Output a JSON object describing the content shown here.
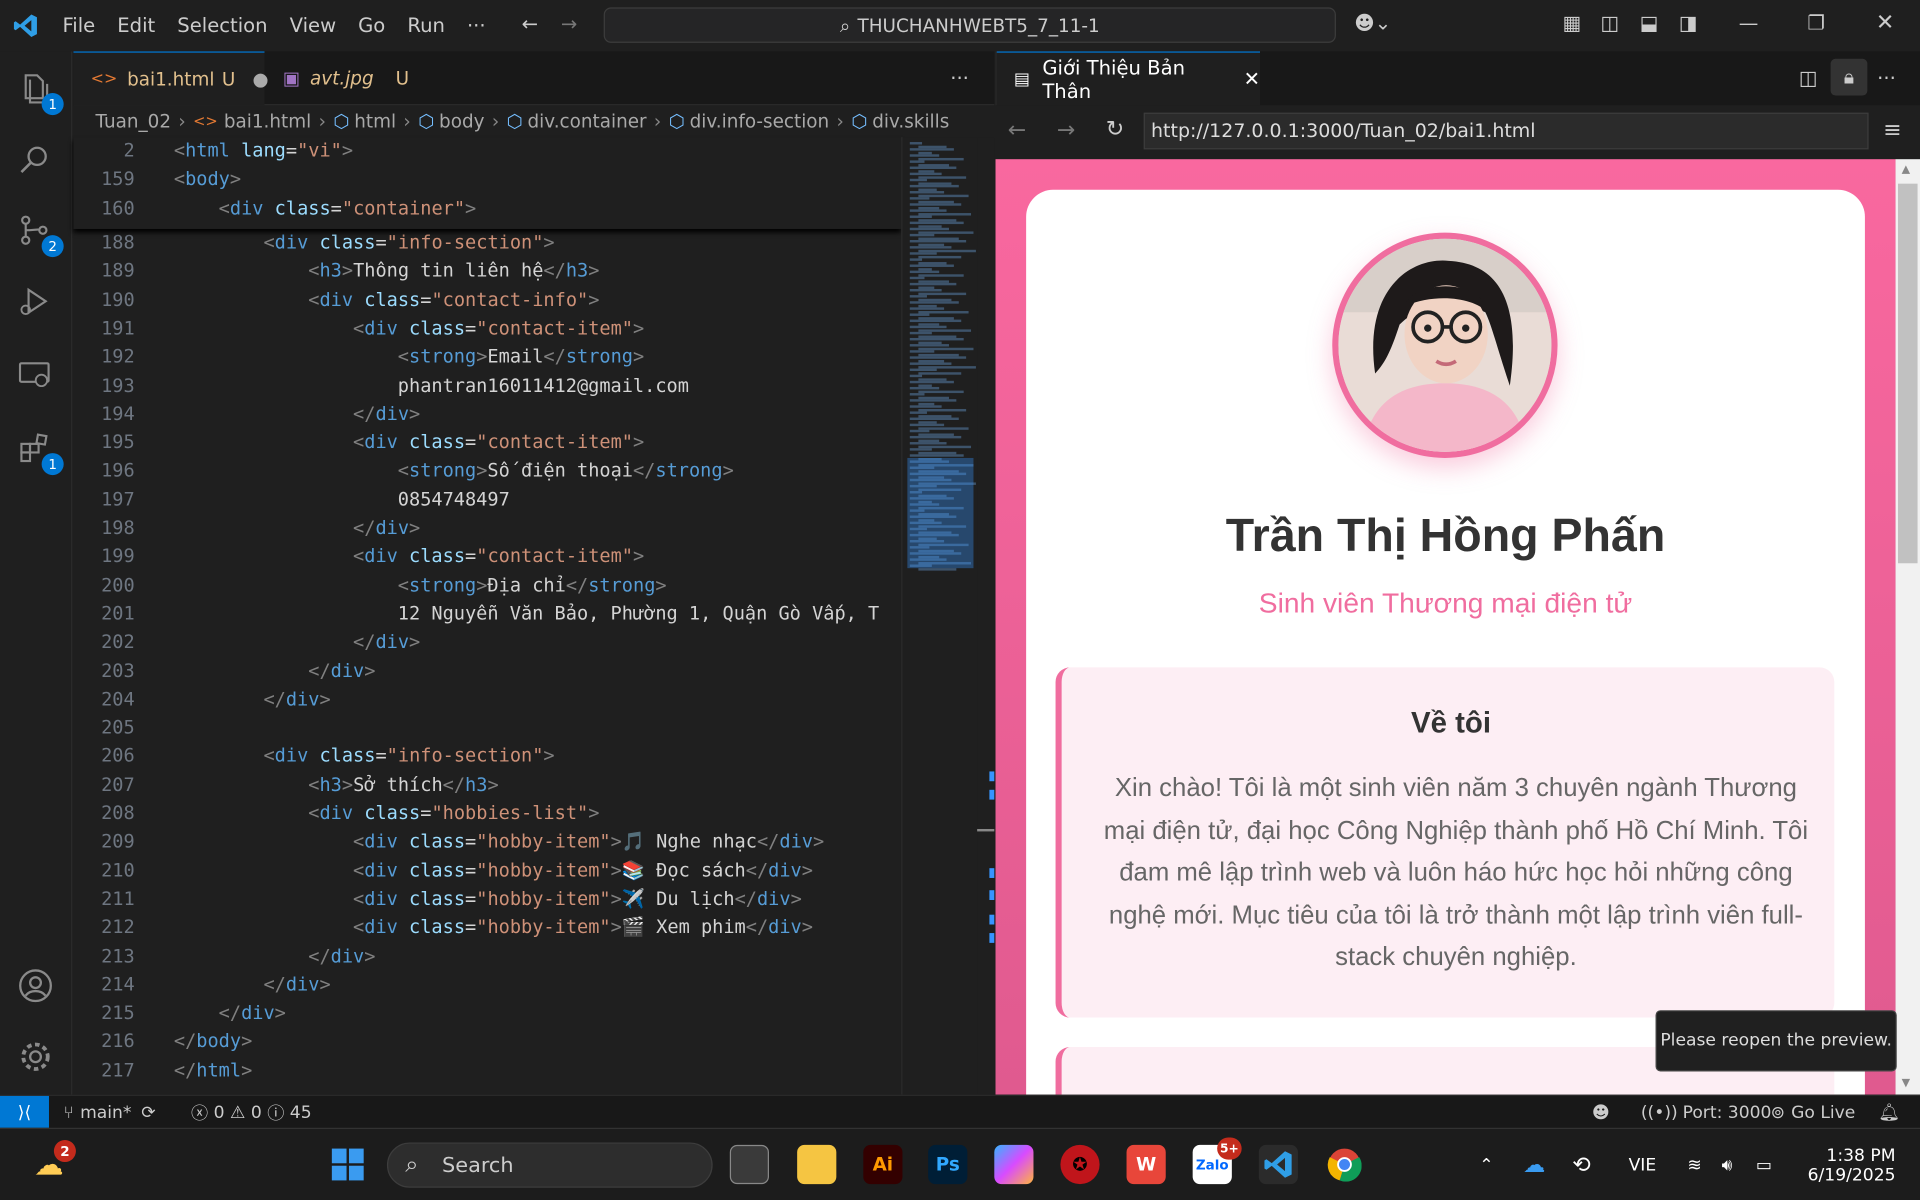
{
  "menu": [
    "File",
    "Edit",
    "Selection",
    "View",
    "Go",
    "Run",
    "···"
  ],
  "command_center": "THUCHANHWEBT5_7_11-1",
  "activity_badges": {
    "explorer": "1",
    "source_control": "2",
    "extensions": "1"
  },
  "tabs": [
    {
      "label": "bai1.html",
      "status": "U"
    },
    {
      "label": "avt.jpg",
      "status": "U"
    }
  ],
  "breadcrumb": [
    "Tuan_02",
    "bai1.html",
    "html",
    "body",
    "div.container",
    "div.info-section",
    "div.skills"
  ],
  "code_lines": [
    {
      "n": "188",
      "i": 2,
      "t": [
        [
          "br",
          "<"
        ],
        [
          "tag",
          "div"
        ],
        [
          "attr",
          " class"
        ],
        [
          "txt",
          "="
        ],
        [
          "str",
          "\"info-section\""
        ],
        [
          "br",
          ">"
        ]
      ]
    },
    {
      "n": "189",
      "i": 3,
      "t": [
        [
          "br",
          "<"
        ],
        [
          "tag",
          "h3"
        ],
        [
          "br",
          ">"
        ],
        [
          "txt",
          "Thông tin liên hệ"
        ],
        [
          "br",
          "</"
        ],
        [
          "tag",
          "h3"
        ],
        [
          "br",
          ">"
        ]
      ]
    },
    {
      "n": "190",
      "i": 3,
      "t": [
        [
          "br",
          "<"
        ],
        [
          "tag",
          "div"
        ],
        [
          "attr",
          " class"
        ],
        [
          "txt",
          "="
        ],
        [
          "str",
          "\"contact-info\""
        ],
        [
          "br",
          ">"
        ]
      ]
    },
    {
      "n": "191",
      "i": 4,
      "t": [
        [
          "br",
          "<"
        ],
        [
          "tag",
          "div"
        ],
        [
          "attr",
          " class"
        ],
        [
          "txt",
          "="
        ],
        [
          "str",
          "\"contact-item\""
        ],
        [
          "br",
          ">"
        ]
      ]
    },
    {
      "n": "192",
      "i": 5,
      "t": [
        [
          "br",
          "<"
        ],
        [
          "tag",
          "strong"
        ],
        [
          "br",
          ">"
        ],
        [
          "txt",
          "Email"
        ],
        [
          "br",
          "</"
        ],
        [
          "tag",
          "strong"
        ],
        [
          "br",
          ">"
        ]
      ]
    },
    {
      "n": "193",
      "i": 5,
      "t": [
        [
          "txt",
          "phantran16011412@gmail.com"
        ]
      ]
    },
    {
      "n": "194",
      "i": 4,
      "t": [
        [
          "br",
          "</"
        ],
        [
          "tag",
          "div"
        ],
        [
          "br",
          ">"
        ]
      ]
    },
    {
      "n": "195",
      "i": 4,
      "t": [
        [
          "br",
          "<"
        ],
        [
          "tag",
          "div"
        ],
        [
          "attr",
          " class"
        ],
        [
          "txt",
          "="
        ],
        [
          "str",
          "\"contact-item\""
        ],
        [
          "br",
          ">"
        ]
      ]
    },
    {
      "n": "196",
      "i": 5,
      "t": [
        [
          "br",
          "<"
        ],
        [
          "tag",
          "strong"
        ],
        [
          "br",
          ">"
        ],
        [
          "txt",
          "Số điện thoại"
        ],
        [
          "br",
          "</"
        ],
        [
          "tag",
          "strong"
        ],
        [
          "br",
          ">"
        ]
      ]
    },
    {
      "n": "197",
      "i": 5,
      "t": [
        [
          "txt",
          "0854748497"
        ]
      ]
    },
    {
      "n": "198",
      "i": 4,
      "t": [
        [
          "br",
          "</"
        ],
        [
          "tag",
          "div"
        ],
        [
          "br",
          ">"
        ]
      ]
    },
    {
      "n": "199",
      "i": 4,
      "t": [
        [
          "br",
          "<"
        ],
        [
          "tag",
          "div"
        ],
        [
          "attr",
          " class"
        ],
        [
          "txt",
          "="
        ],
        [
          "str",
          "\"contact-item\""
        ],
        [
          "br",
          ">"
        ]
      ]
    },
    {
      "n": "200",
      "i": 5,
      "t": [
        [
          "br",
          "<"
        ],
        [
          "tag",
          "strong"
        ],
        [
          "br",
          ">"
        ],
        [
          "txt",
          "Địa chỉ"
        ],
        [
          "br",
          "</"
        ],
        [
          "tag",
          "strong"
        ],
        [
          "br",
          ">"
        ]
      ]
    },
    {
      "n": "201",
      "i": 5,
      "t": [
        [
          "txt",
          "12 Nguyễn Văn Bảo, Phường 1, Quận Gò Vấp, T"
        ]
      ]
    },
    {
      "n": "202",
      "i": 4,
      "t": [
        [
          "br",
          "</"
        ],
        [
          "tag",
          "div"
        ],
        [
          "br",
          ">"
        ]
      ]
    },
    {
      "n": "203",
      "i": 3,
      "t": [
        [
          "br",
          "</"
        ],
        [
          "tag",
          "div"
        ],
        [
          "br",
          ">"
        ]
      ]
    },
    {
      "n": "204",
      "i": 2,
      "t": [
        [
          "br",
          "</"
        ],
        [
          "tag",
          "div"
        ],
        [
          "br",
          ">"
        ]
      ]
    },
    {
      "n": "205",
      "i": 0,
      "t": []
    },
    {
      "n": "206",
      "i": 2,
      "t": [
        [
          "br",
          "<"
        ],
        [
          "tag",
          "div"
        ],
        [
          "attr",
          " class"
        ],
        [
          "txt",
          "="
        ],
        [
          "str",
          "\"info-section\""
        ],
        [
          "br",
          ">"
        ]
      ]
    },
    {
      "n": "207",
      "i": 3,
      "t": [
        [
          "br",
          "<"
        ],
        [
          "tag",
          "h3"
        ],
        [
          "br",
          ">"
        ],
        [
          "txt",
          "Sở thích"
        ],
        [
          "br",
          "</"
        ],
        [
          "tag",
          "h3"
        ],
        [
          "br",
          ">"
        ]
      ]
    },
    {
      "n": "208",
      "i": 3,
      "t": [
        [
          "br",
          "<"
        ],
        [
          "tag",
          "div"
        ],
        [
          "attr",
          " class"
        ],
        [
          "txt",
          "="
        ],
        [
          "str",
          "\"hobbies-list\""
        ],
        [
          "br",
          ">"
        ]
      ]
    },
    {
      "n": "209",
      "i": 4,
      "t": [
        [
          "br",
          "<"
        ],
        [
          "tag",
          "div"
        ],
        [
          "attr",
          " class"
        ],
        [
          "txt",
          "="
        ],
        [
          "str",
          "\"hobby-item\""
        ],
        [
          "br",
          ">"
        ],
        [
          "txt",
          "🎵 Nghe nhạc"
        ],
        [
          "br",
          "</"
        ],
        [
          "tag",
          "div"
        ],
        [
          "br",
          ">"
        ]
      ]
    },
    {
      "n": "210",
      "i": 4,
      "t": [
        [
          "br",
          "<"
        ],
        [
          "tag",
          "div"
        ],
        [
          "attr",
          " class"
        ],
        [
          "txt",
          "="
        ],
        [
          "str",
          "\"hobby-item\""
        ],
        [
          "br",
          ">"
        ],
        [
          "txt",
          "📚 Đọc sách"
        ],
        [
          "br",
          "</"
        ],
        [
          "tag",
          "div"
        ],
        [
          "br",
          ">"
        ]
      ]
    },
    {
      "n": "211",
      "i": 4,
      "t": [
        [
          "br",
          "<"
        ],
        [
          "tag",
          "div"
        ],
        [
          "attr",
          " class"
        ],
        [
          "txt",
          "="
        ],
        [
          "str",
          "\"hobby-item\""
        ],
        [
          "br",
          ">"
        ],
        [
          "txt",
          "✈️ Du lịch"
        ],
        [
          "br",
          "</"
        ],
        [
          "tag",
          "div"
        ],
        [
          "br",
          ">"
        ]
      ]
    },
    {
      "n": "212",
      "i": 4,
      "t": [
        [
          "br",
          "<"
        ],
        [
          "tag",
          "div"
        ],
        [
          "attr",
          " class"
        ],
        [
          "txt",
          "="
        ],
        [
          "str",
          "\"hobby-item\""
        ],
        [
          "br",
          ">"
        ],
        [
          "txt",
          "🎬 Xem phim"
        ],
        [
          "br",
          "</"
        ],
        [
          "tag",
          "div"
        ],
        [
          "br",
          ">"
        ]
      ]
    },
    {
      "n": "213",
      "i": 3,
      "t": [
        [
          "br",
          "</"
        ],
        [
          "tag",
          "div"
        ],
        [
          "br",
          ">"
        ]
      ]
    },
    {
      "n": "214",
      "i": 2,
      "t": [
        [
          "br",
          "</"
        ],
        [
          "tag",
          "div"
        ],
        [
          "br",
          ">"
        ]
      ]
    },
    {
      "n": "215",
      "i": 1,
      "t": [
        [
          "br",
          "</"
        ],
        [
          "tag",
          "div"
        ],
        [
          "br",
          ">"
        ]
      ]
    },
    {
      "n": "216",
      "i": 0,
      "t": [
        [
          "br",
          "</"
        ],
        [
          "tag",
          "body"
        ],
        [
          "br",
          ">"
        ]
      ]
    },
    {
      "n": "217",
      "i": 0,
      "t": [
        [
          "br",
          "</"
        ],
        [
          "tag",
          "html"
        ],
        [
          "br",
          ">"
        ]
      ]
    }
  ],
  "sticky_lines": [
    {
      "n": "2",
      "i": 0,
      "t": [
        [
          "br",
          "<"
        ],
        [
          "tag",
          "html"
        ],
        [
          "attr",
          " lang"
        ],
        [
          "txt",
          "="
        ],
        [
          "str",
          "\"vi\""
        ],
        [
          "br",
          ">"
        ]
      ]
    },
    {
      "n": "159",
      "i": 0,
      "t": [
        [
          "br",
          "<"
        ],
        [
          "tag",
          "body"
        ],
        [
          "br",
          ">"
        ]
      ]
    },
    {
      "n": "160",
      "i": 1,
      "t": [
        [
          "br",
          "<"
        ],
        [
          "tag",
          "div"
        ],
        [
          "attr",
          " class"
        ],
        [
          "txt",
          "="
        ],
        [
          "str",
          "\"container\""
        ],
        [
          "br",
          ">"
        ]
      ]
    }
  ],
  "preview": {
    "tab_title": "Giới Thiệu Bản Thân",
    "url": "http://127.0.0.1:3000/Tuan_02/bai1.html",
    "name": "Trần Thị Hồng Phấn",
    "role": "Sinh viên Thương mại điện tử",
    "about_title": "Về tôi",
    "about_text": "Xin chào! Tôi là một sinh viên năm 3 chuyên ngành Thương mại điện tử, đại học Công Nghiệp thành phố Hồ Chí Minh. Tôi đam mê lập trình web và luôn háo hức học hỏi những công nghệ mới. Mục tiêu của tôi là trở thành một lập trình viên full-stack chuyên nghiệp.",
    "toast": "Please reopen the preview."
  },
  "status": {
    "branch": "main*",
    "errors": "0",
    "warnings": "0",
    "infos": "45",
    "port": "Port: 3000",
    "golive": "Go Live"
  },
  "taskbar": {
    "search": "Search",
    "weather_badge": "2",
    "zalo_badge": "5+",
    "lang": "VIE",
    "time": "1:38 PM",
    "date": "6/19/2025"
  },
  "colors": {
    "accent": "#0078d4",
    "pink": "#f06d9f",
    "bg": "#1f1f1f"
  }
}
